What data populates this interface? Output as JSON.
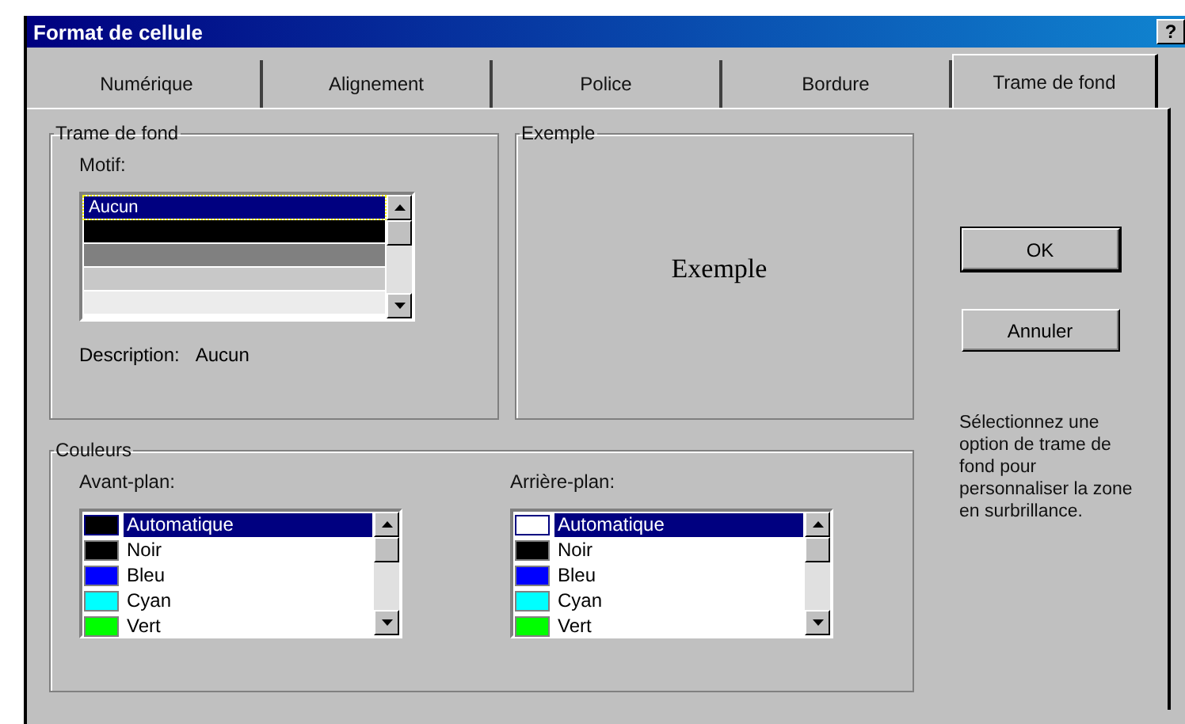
{
  "window": {
    "title": "Format de cellule",
    "help_button": "?"
  },
  "tabs": [
    {
      "label": "Numérique",
      "selected": false
    },
    {
      "label": "Alignement",
      "selected": false
    },
    {
      "label": "Police",
      "selected": false
    },
    {
      "label": "Bordure",
      "selected": false
    },
    {
      "label": "Trame de fond",
      "selected": true
    }
  ],
  "pattern_group": {
    "title": "Trame de fond",
    "list_label": "Motif:",
    "items": [
      {
        "label": "Aucun",
        "selected": true,
        "color": "#000080"
      },
      {
        "selected": false,
        "color": "#000000"
      },
      {
        "selected": false,
        "color": "#808080"
      },
      {
        "selected": false,
        "color": "#c8c8c8"
      },
      {
        "selected": false,
        "color": "#ececec"
      }
    ],
    "description_label": "Description:",
    "description_value": "Aucun"
  },
  "example_group": {
    "title": "Exemple",
    "sample": "Exemple"
  },
  "colors_group": {
    "title": "Couleurs",
    "lists": [
      {
        "label": "Avant-plan:",
        "items": [
          {
            "name": "Automatique",
            "color": "#000000",
            "selected": true
          },
          {
            "name": "Noir",
            "color": "#000000",
            "selected": false
          },
          {
            "name": "Bleu",
            "color": "#0000ff",
            "selected": false
          },
          {
            "name": "Cyan",
            "color": "#00ffff",
            "selected": false
          },
          {
            "name": "Vert",
            "color": "#00ff00",
            "selected": false
          }
        ]
      },
      {
        "label": "Arrière-plan:",
        "items": [
          {
            "name": "Automatique",
            "color": "#ffffff",
            "selected": true
          },
          {
            "name": "Noir",
            "color": "#000000",
            "selected": false
          },
          {
            "name": "Bleu",
            "color": "#0000ff",
            "selected": false
          },
          {
            "name": "Cyan",
            "color": "#00ffff",
            "selected": false
          },
          {
            "name": "Vert",
            "color": "#00ff00",
            "selected": false
          }
        ]
      }
    ]
  },
  "buttons": [
    {
      "label": "OK",
      "default": true
    },
    {
      "label": "Annuler",
      "default": false
    }
  ],
  "hint": "Sélectionnez une option de trame de fond pour personnaliser la zone en surbrillance."
}
